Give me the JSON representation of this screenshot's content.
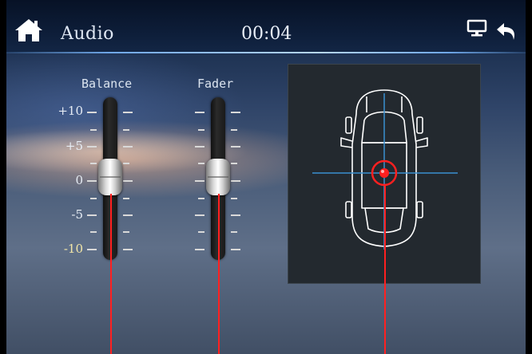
{
  "header": {
    "title": "Audio",
    "time": "00:04",
    "icons": {
      "home": "home-icon",
      "display": "monitor-icon",
      "back": "back-arrow-icon"
    }
  },
  "balance": {
    "label": "Balance",
    "scale": [
      "+10",
      "+5",
      "0",
      "-5",
      "-10"
    ],
    "value": 0
  },
  "fader": {
    "label": "Fader",
    "value": 0
  },
  "colors": {
    "accent": "#6fa7e8",
    "focus_point": "#ff2020",
    "car_outline": "#ffffff",
    "crosshair": "#3a8fd0"
  }
}
